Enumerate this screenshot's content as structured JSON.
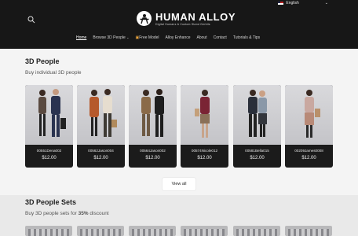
{
  "header": {
    "language": "English",
    "brand": {
      "title": "HUMAN ALLOY",
      "tagline": "Digital Humans & Custom Stand Gerbils"
    },
    "nav": [
      "Home",
      "Browse 3D People",
      "Free Model",
      "Alloy Enhance",
      "About",
      "Contact",
      "Tutorials & Tips"
    ]
  },
  "section_people": {
    "title": "3D People",
    "subtitle": "Buy individual 3D people",
    "products": [
      {
        "name": "00551Dena002",
        "price": "$12.00"
      },
      {
        "name": "00562Jason004",
        "price": "$12.00"
      },
      {
        "name": "00564Jason002",
        "price": "$12.00"
      },
      {
        "name": "00574Nicole012",
        "price": "$12.00"
      },
      {
        "name": "00581Bella015",
        "price": "$12.00"
      },
      {
        "name": "00209James0008",
        "price": "$12.00"
      }
    ],
    "view_all": "View all"
  },
  "section_sets": {
    "title": "3D People Sets",
    "subtitle_pre": "Buy 3D people sets for ",
    "subtitle_bold": "35%",
    "subtitle_post": " discount"
  },
  "colors": {
    "header_bg": "#171717",
    "card_bg": "#1b1b1b",
    "page_bg": "#f4f4f4"
  }
}
